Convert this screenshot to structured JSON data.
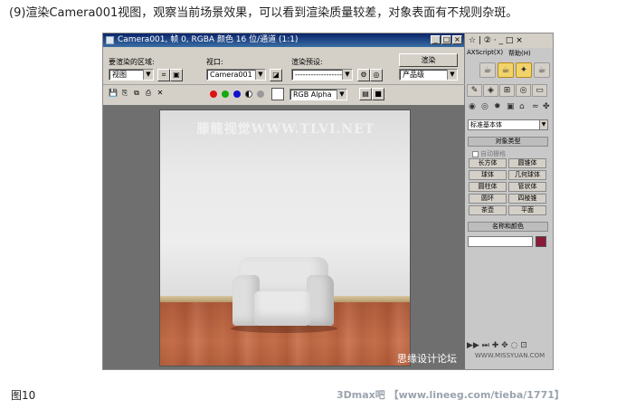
{
  "captions": {
    "top": "(9)渲染Camera001视图，观察当前场景效果，可以看到渲染质量较差，对象表面有不规则杂斑。",
    "bottom": "图10",
    "credit": "3Dmax吧 【www.lineeg.com/tieba/1771】"
  },
  "render_window": {
    "title": "Camera001, 帧 0, RGBA 颜色 16 位/通道 (1:1)",
    "area_label": "要渲染的区域:",
    "area_value": "视图",
    "viewport_label": "视口:",
    "viewport_value": "Camera001",
    "preset_label": "渲染预设:",
    "preset_value": "--------------------",
    "render_button": "渲染",
    "quality_value": "产品级",
    "channel_value": "RGB Alpha",
    "window_buttons": [
      "_",
      "□",
      "×"
    ]
  },
  "render_image": {
    "watermark_top": "滕龍视觉WWW.TLVI.NET",
    "watermark_bottom": "思缘设计论坛"
  },
  "command_panel": {
    "top_icons": "☆ | ② ·  _ □ ×",
    "menu_script": "AXScript(X)",
    "menu_help": "帮助(H)",
    "category_dropdown": "标准基本体",
    "object_type_header": "对象类型",
    "autogrid_label": "自动栅格",
    "object_buttons": [
      "长方体",
      "圆锥体",
      "球体",
      "几何球体",
      "圆柱体",
      "管状体",
      "圆环",
      "四棱锥",
      "茶壶",
      "平面"
    ],
    "name_color_header": "名称和颜色",
    "bottom_watermark": "WWW.MISSYUAN.COM",
    "swatch_color": "#8b1a38"
  }
}
